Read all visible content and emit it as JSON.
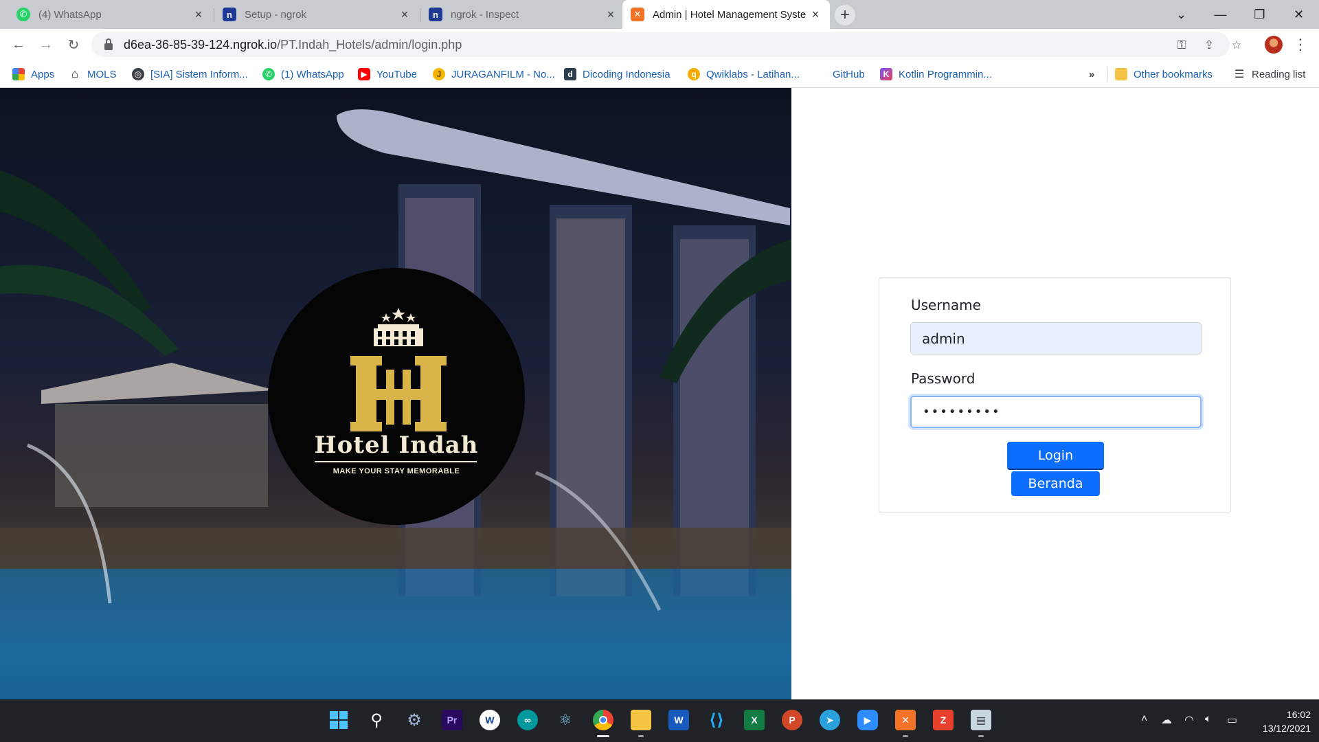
{
  "browser": {
    "tabs": [
      {
        "title": "(4) WhatsApp",
        "icon": "whatsapp-icon",
        "active": false
      },
      {
        "title": "Setup - ngrok",
        "icon": "ngrok-icon",
        "active": false
      },
      {
        "title": "ngrok - Inspect",
        "icon": "ngrok-icon",
        "active": false
      },
      {
        "title": "Admin | Hotel Management Syste",
        "icon": "xampp-icon",
        "active": true
      }
    ],
    "url_host": "d6ea-36-85-39-124.ngrok.io",
    "url_path": "/PT.Indah_Hotels/admin/login.php",
    "bookmarks": [
      {
        "label": "Apps",
        "icon": "apps-grid-icon"
      },
      {
        "label": "MOLS",
        "icon": "home-icon"
      },
      {
        "label": "[SIA] Sistem Inform...",
        "icon": "globe-icon"
      },
      {
        "label": "(1) WhatsApp",
        "icon": "whatsapp-icon"
      },
      {
        "label": "YouTube",
        "icon": "youtube-icon"
      },
      {
        "label": "JURAGANFILM - No...",
        "icon": "juraganfilm-icon"
      },
      {
        "label": "Dicoding Indonesia",
        "icon": "dicoding-icon"
      },
      {
        "label": "Qwiklabs - Latihan...",
        "icon": "qwiklabs-icon"
      },
      {
        "label": "GitHub",
        "icon": "github-icon"
      },
      {
        "label": "Kotlin Programmin...",
        "icon": "kotlin-icon"
      }
    ],
    "overflow_label": "»",
    "other_bookmarks": "Other bookmarks",
    "reading_list": "Reading list"
  },
  "hero": {
    "hotel_name": "Hotel Indah",
    "tagline": "MAKE YOUR STAY MEMORABLE",
    "monogram": "H"
  },
  "login": {
    "username_label": "Username",
    "username_value": "admin",
    "password_label": "Password",
    "password_value": "•••••••••",
    "login_button": "Login",
    "home_button": "Beranda",
    "primary_color": "#0d6efd"
  },
  "taskbar": {
    "time": "16:02",
    "date": "13/12/2021"
  }
}
